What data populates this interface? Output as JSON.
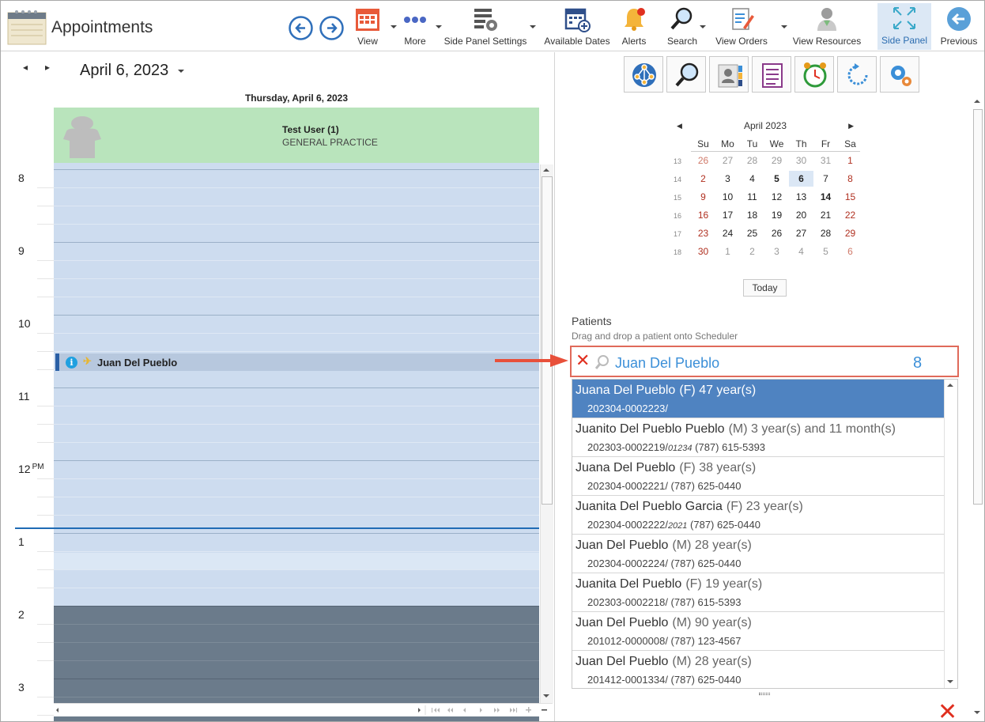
{
  "app": {
    "title": "Appointments"
  },
  "toolbar": {
    "buttons": [
      {
        "label": "View",
        "icon": "calendar-grid-icon"
      },
      {
        "label": "More",
        "icon": "more-dots-icon"
      },
      {
        "label": "Side Panel Settings",
        "icon": "panel-settings-icon"
      },
      {
        "label": "Available Dates",
        "icon": "calendar-add-icon"
      },
      {
        "label": "Alerts",
        "icon": "bell-icon"
      },
      {
        "label": "Search",
        "icon": "search-icon"
      },
      {
        "label": "View Orders",
        "icon": "orders-icon"
      },
      {
        "label": "View Resources",
        "icon": "resource-person-icon"
      },
      {
        "label": "Side Panel",
        "icon": "expand-icon"
      },
      {
        "label": "Previous",
        "icon": "back-arrow-icon"
      }
    ]
  },
  "scheduler": {
    "date_title": "April 6, 2023",
    "day_header": "Thursday, April 6, 2023",
    "resource": {
      "name": "Test User (1)",
      "specialty": "GENERAL PRACTICE"
    },
    "hours": [
      "8",
      "9",
      "10",
      "11",
      "12",
      "1",
      "2",
      "3"
    ],
    "pm_marker": "PM",
    "appointment": {
      "patient": "Juan Del Pueblo"
    }
  },
  "calendar": {
    "month_title": "April 2023",
    "dow": [
      "Su",
      "Mo",
      "Tu",
      "We",
      "Th",
      "Fr",
      "Sa"
    ],
    "weeks": [
      {
        "wk": "13",
        "days": [
          "26",
          "27",
          "28",
          "29",
          "30",
          "31",
          "1"
        ]
      },
      {
        "wk": "14",
        "days": [
          "2",
          "3",
          "4",
          "5",
          "6",
          "7",
          "8"
        ]
      },
      {
        "wk": "15",
        "days": [
          "9",
          "10",
          "11",
          "12",
          "13",
          "14",
          "15"
        ]
      },
      {
        "wk": "16",
        "days": [
          "16",
          "17",
          "18",
          "19",
          "20",
          "21",
          "22"
        ]
      },
      {
        "wk": "17",
        "days": [
          "23",
          "24",
          "25",
          "26",
          "27",
          "28",
          "29"
        ]
      },
      {
        "wk": "18",
        "days": [
          "30",
          "1",
          "2",
          "3",
          "4",
          "5",
          "6"
        ]
      }
    ],
    "selected_day": "6",
    "today_label": "Today"
  },
  "patients": {
    "label": "Patients",
    "hint": "Drag and drop a patient onto Scheduler",
    "search_value": "Juan Del Pueblo",
    "result_count": "8",
    "items": [
      {
        "name": "Juana Del Pueblo",
        "detail": "(F) 47 year(s)",
        "id": "202304-0002223/",
        "extra": "",
        "phone": ""
      },
      {
        "name": "Juanito Del Pueblo Pueblo",
        "detail": "(M) 3 year(s) and 11 month(s)",
        "id": "202303-0002219/",
        "extra": "01234",
        "phone": " (787) 615-5393"
      },
      {
        "name": "Juana Del Pueblo",
        "detail": "(F) 38 year(s)",
        "id": "202304-0002221/",
        "extra": "",
        "phone": " (787) 625-0440"
      },
      {
        "name": "Juanita Del Pueblo Garcia",
        "detail": "(F) 23 year(s)",
        "id": "202304-0002222/",
        "extra": "2021",
        "phone": " (787) 625-0440"
      },
      {
        "name": "Juan Del Pueblo",
        "detail": "(M) 28 year(s)",
        "id": "202304-0002224/",
        "extra": "",
        "phone": " (787) 625-0440"
      },
      {
        "name": "Juanita Del Pueblo",
        "detail": "(F) 19 year(s)",
        "id": "202303-0002218/",
        "extra": "",
        "phone": " (787) 615-5393"
      },
      {
        "name": "Juan Del Pueblo",
        "detail": "(M) 90 year(s)",
        "id": "201012-0000008/",
        "extra": "",
        "phone": " (787) 123-4567"
      },
      {
        "name": "Juan Del Pueblo",
        "detail": "(M) 28 year(s)",
        "id": "201412-0001334/",
        "extra": "",
        "phone": " (787) 625-0440"
      }
    ]
  }
}
